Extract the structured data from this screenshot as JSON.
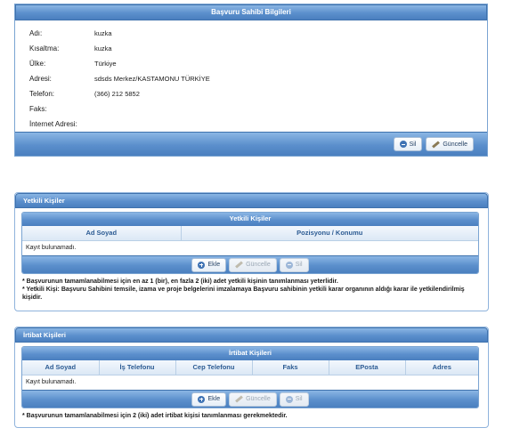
{
  "applicant": {
    "title": "Başvuru Sahibi Bilgileri",
    "fields": [
      {
        "label": "Adı:",
        "value": "kuzka"
      },
      {
        "label": "Kısaltma:",
        "value": "kuzka"
      },
      {
        "label": "Ülke:",
        "value": "Türkiye"
      },
      {
        "label": "Adresi:",
        "value": "sdsds Merkez/KASTAMONU TÜRKİYE"
      },
      {
        "label": "Telefon:",
        "value": "(366) 212 5852"
      },
      {
        "label": "Faks:",
        "value": ""
      },
      {
        "label": "İnternet Adresi:",
        "value": ""
      }
    ],
    "delete_label": "Sil",
    "update_label": "Güncelle"
  },
  "authorized": {
    "panel_title": "Yetkili Kişiler",
    "grid_title": "Yetkili Kişiler",
    "columns": [
      "Ad Soyad",
      "Pozisyonu / Konumu"
    ],
    "empty_text": "Kayıt bulunamadı.",
    "add_label": "Ekle",
    "update_label": "Güncelle",
    "delete_label": "Sil",
    "notes": [
      "* Başvurunun tamamlanabilmesi için en az 1 (bir), en fazla 2 (iki) adet yetkili kişinin tanımlanması yeterlidir.",
      "* Yetkili Kişi: Başvuru Sahibini temsile, izama ve proje belgelerini imzalamaya Başvuru sahibinin yetkili karar organının aldığı karar ile yetkilendirilmiş kişidir."
    ]
  },
  "contacts": {
    "panel_title": "İrtibat Kişileri",
    "grid_title": "İrtibat Kişileri",
    "columns": [
      "Ad Soyad",
      "İş Telefonu",
      "Cep Telefonu",
      "Faks",
      "EPosta",
      "Adres"
    ],
    "empty_text": "Kayıt bulunamadı.",
    "add_label": "Ekle",
    "update_label": "Güncelle",
    "delete_label": "Sil",
    "notes": [
      "* Başvurunun tamamlanabilmesi için 2 (iki) adet irtibat kişisi tanımlanması gerekmektedir."
    ]
  }
}
